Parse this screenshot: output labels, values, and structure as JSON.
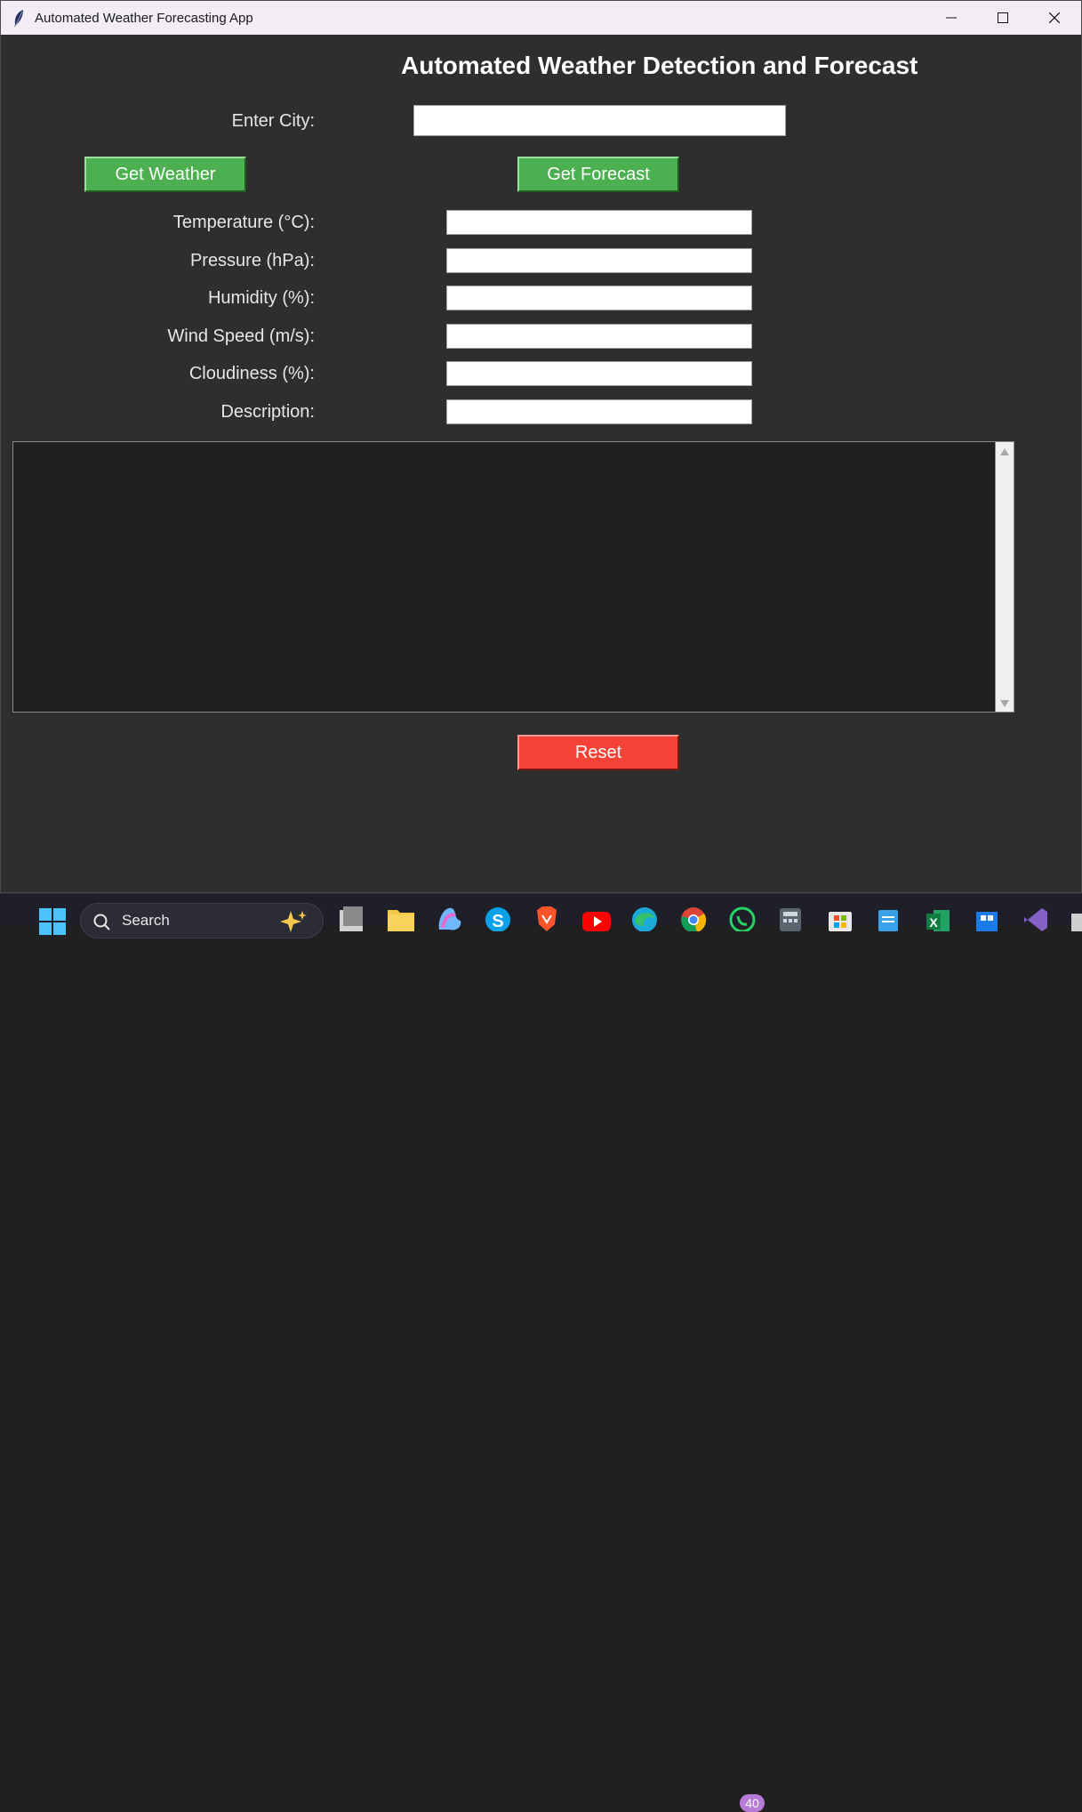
{
  "window": {
    "title": "Automated Weather Forecasting App"
  },
  "main": {
    "heading": "Automated Weather Detection and Forecast",
    "city_label": "Enter City:",
    "city_value": "",
    "get_weather_label": "Get Weather",
    "get_forecast_label": "Get Forecast",
    "fields": [
      {
        "label": "Temperature (°C):",
        "value": ""
      },
      {
        "label": "Pressure (hPa):",
        "value": ""
      },
      {
        "label": "Humidity (%):",
        "value": ""
      },
      {
        "label": "Wind Speed (m/s):",
        "value": ""
      },
      {
        "label": "Cloudiness (%):",
        "value": ""
      },
      {
        "label": "Description:",
        "value": ""
      }
    ],
    "output_text": "",
    "reset_label": "Reset"
  },
  "colors": {
    "background": "#2e2e2e",
    "button_green": "#4caf50",
    "button_red": "#f44336",
    "output_bg": "#1f1f1f"
  },
  "taskbar": {
    "search_text": "Search",
    "notification_badge": "40",
    "icons": [
      "windows-start-icon",
      "search-icon",
      "task-view-icon",
      "file-explorer-icon",
      "copilot-icon",
      "skype-icon",
      "brave-icon",
      "youtube-icon",
      "edge-icon",
      "chrome-icon",
      "whatsapp-icon",
      "calculator-icon",
      "microsoft-store-icon",
      "notepad-icon",
      "excel-icon",
      "windows-app-icon",
      "visual-studio-icon"
    ]
  }
}
